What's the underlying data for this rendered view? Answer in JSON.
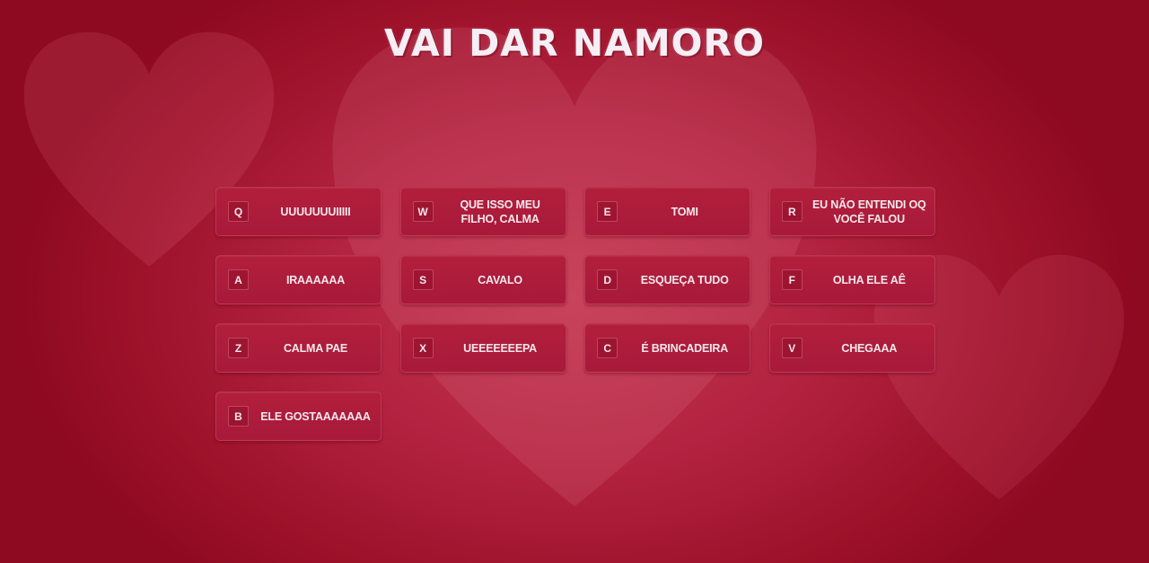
{
  "page": {
    "title": "VAI DAR NAMORO"
  },
  "colors": {
    "background": "#b32341",
    "button": "#a8193a",
    "text": "#f4e8ec"
  },
  "buttons": [
    {
      "key": "Q",
      "label": "UUUUUUUIIIII"
    },
    {
      "key": "W",
      "label": "QUE ISSO MEU\nFILHO, CALMA"
    },
    {
      "key": "E",
      "label": "TOMI"
    },
    {
      "key": "R",
      "label": "EU NÃO ENTENDI OQ\nVOCÊ FALOU"
    },
    {
      "key": "A",
      "label": "IRAAAAAA"
    },
    {
      "key": "S",
      "label": "CAVALO"
    },
    {
      "key": "D",
      "label": "ESQUEÇA TUDO"
    },
    {
      "key": "F",
      "label": "OLHA ELE AÊ"
    },
    {
      "key": "Z",
      "label": "CALMA PAE"
    },
    {
      "key": "X",
      "label": "UEEEEEEEPA"
    },
    {
      "key": "C",
      "label": "É BRINCADEIRA"
    },
    {
      "key": "V",
      "label": "CHEGAAA"
    },
    {
      "key": "B",
      "label": "ELE GOSTAAAAAAA"
    }
  ]
}
